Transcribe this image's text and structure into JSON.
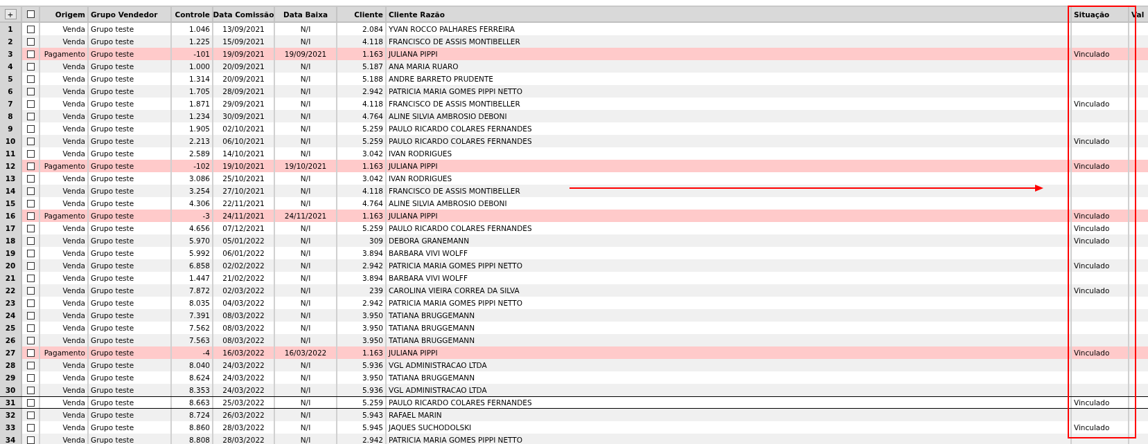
{
  "grid": {
    "expand_button": "+",
    "select_all_checked": false,
    "columns": [
      "Origem",
      "Grupo Vendedor",
      "Controle",
      "Data Comissão",
      "Data Baixa",
      "Cliente",
      "Cliente Razão",
      "Situação",
      "Val"
    ],
    "rows": [
      {
        "number": "1",
        "checked": false,
        "highlighted": false,
        "selected": false,
        "cells": [
          "Venda",
          "Grupo teste",
          "1.046",
          "13/09/2021",
          "N/I",
          "2.084",
          "YVAN ROCCO PALHARES FERREIRA"
        ]
      },
      {
        "number": "2",
        "checked": false,
        "highlighted": false,
        "selected": false,
        "cells": [
          "Venda",
          "Grupo teste",
          "1.225",
          "15/09/2021",
          "N/I",
          "4.118",
          "FRANCISCO DE ASSIS MONTIBELLER"
        ]
      },
      {
        "number": "3",
        "checked": false,
        "highlighted": true,
        "selected": false,
        "cells": [
          "Pagamento",
          "Grupo teste",
          "-101",
          "19/09/2021",
          "19/09/2021",
          "1.163",
          "JULIANA PIPPI"
        ],
        "situacao": "Vinculado"
      },
      {
        "number": "4",
        "checked": false,
        "highlighted": false,
        "selected": false,
        "cells": [
          "Venda",
          "Grupo teste",
          "1.000",
          "20/09/2021",
          "N/I",
          "5.187",
          "ANA MARIA RUARO"
        ]
      },
      {
        "number": "5",
        "checked": false,
        "highlighted": false,
        "selected": false,
        "cells": [
          "Venda",
          "Grupo teste",
          "1.314",
          "20/09/2021",
          "N/I",
          "5.188",
          "ANDRE BARRETO PRUDENTE"
        ]
      },
      {
        "number": "6",
        "checked": false,
        "highlighted": false,
        "selected": false,
        "cells": [
          "Venda",
          "Grupo teste",
          "1.705",
          "28/09/2021",
          "N/I",
          "2.942",
          "PATRICIA MARIA GOMES PIPPI NETTO"
        ]
      },
      {
        "number": "7",
        "checked": false,
        "highlighted": false,
        "selected": false,
        "cells": [
          "Venda",
          "Grupo teste",
          "1.871",
          "29/09/2021",
          "N/I",
          "4.118",
          "FRANCISCO DE ASSIS MONTIBELLER"
        ],
        "situacao": "Vinculado"
      },
      {
        "number": "8",
        "checked": false,
        "highlighted": false,
        "selected": false,
        "cells": [
          "Venda",
          "Grupo teste",
          "1.234",
          "30/09/2021",
          "N/I",
          "4.764",
          "ALINE SILVIA AMBROSIO DEBONI"
        ]
      },
      {
        "number": "9",
        "checked": false,
        "highlighted": false,
        "selected": false,
        "cells": [
          "Venda",
          "Grupo teste",
          "1.905",
          "02/10/2021",
          "N/I",
          "5.259",
          "PAULO RICARDO COLARES FERNANDES"
        ]
      },
      {
        "number": "10",
        "checked": false,
        "highlighted": false,
        "selected": false,
        "cells": [
          "Venda",
          "Grupo teste",
          "2.213",
          "06/10/2021",
          "N/I",
          "5.259",
          "PAULO RICARDO COLARES FERNANDES"
        ],
        "situacao": "Vinculado"
      },
      {
        "number": "11",
        "checked": false,
        "highlighted": false,
        "selected": false,
        "cells": [
          "Venda",
          "Grupo teste",
          "2.589",
          "14/10/2021",
          "N/I",
          "3.042",
          "IVAN RODRIGUES"
        ]
      },
      {
        "number": "12",
        "checked": false,
        "highlighted": true,
        "selected": false,
        "cells": [
          "Pagamento",
          "Grupo teste",
          "-102",
          "19/10/2021",
          "19/10/2021",
          "1.163",
          "JULIANA PIPPI"
        ],
        "situacao": "Vinculado"
      },
      {
        "number": "13",
        "checked": false,
        "highlighted": false,
        "selected": false,
        "cells": [
          "Venda",
          "Grupo teste",
          "3.086",
          "25/10/2021",
          "N/I",
          "3.042",
          "IVAN RODRIGUES"
        ]
      },
      {
        "number": "14",
        "checked": false,
        "highlighted": false,
        "selected": false,
        "cells": [
          "Venda",
          "Grupo teste",
          "3.254",
          "27/10/2021",
          "N/I",
          "4.118",
          "FRANCISCO DE ASSIS MONTIBELLER"
        ]
      },
      {
        "number": "15",
        "checked": false,
        "highlighted": false,
        "selected": false,
        "cells": [
          "Venda",
          "Grupo teste",
          "4.306",
          "22/11/2021",
          "N/I",
          "4.764",
          "ALINE SILVIA AMBROSIO DEBONI"
        ]
      },
      {
        "number": "16",
        "checked": false,
        "highlighted": true,
        "selected": false,
        "cells": [
          "Pagamento",
          "Grupo teste",
          "-3",
          "24/11/2021",
          "24/11/2021",
          "1.163",
          "JULIANA PIPPI"
        ],
        "situacao": "Vinculado"
      },
      {
        "number": "17",
        "checked": false,
        "highlighted": false,
        "selected": false,
        "cells": [
          "Venda",
          "Grupo teste",
          "4.656",
          "07/12/2021",
          "N/I",
          "5.259",
          "PAULO RICARDO COLARES FERNANDES"
        ],
        "situacao": "Vinculado"
      },
      {
        "number": "18",
        "checked": false,
        "highlighted": false,
        "selected": false,
        "cells": [
          "Venda",
          "Grupo teste",
          "5.970",
          "05/01/2022",
          "N/I",
          "309",
          "DEBORA GRANEMANN"
        ],
        "situacao": "Vinculado"
      },
      {
        "number": "19",
        "checked": false,
        "highlighted": false,
        "selected": false,
        "cells": [
          "Venda",
          "Grupo teste",
          "5.992",
          "06/01/2022",
          "N/I",
          "3.894",
          "BARBARA VIVI WOLFF"
        ]
      },
      {
        "number": "20",
        "checked": false,
        "highlighted": false,
        "selected": false,
        "cells": [
          "Venda",
          "Grupo teste",
          "6.858",
          "02/02/2022",
          "N/I",
          "2.942",
          "PATRICIA MARIA GOMES PIPPI NETTO"
        ],
        "situacao": "Vinculado"
      },
      {
        "number": "21",
        "checked": false,
        "highlighted": false,
        "selected": false,
        "cells": [
          "Venda",
          "Grupo teste",
          "1.447",
          "21/02/2022",
          "N/I",
          "3.894",
          "BARBARA VIVI WOLFF"
        ]
      },
      {
        "number": "22",
        "checked": false,
        "highlighted": false,
        "selected": false,
        "cells": [
          "Venda",
          "Grupo teste",
          "7.872",
          "02/03/2022",
          "N/I",
          "239",
          "CAROLINA VIEIRA CORREA DA SILVA"
        ],
        "situacao": "Vinculado"
      },
      {
        "number": "23",
        "checked": false,
        "highlighted": false,
        "selected": false,
        "cells": [
          "Venda",
          "Grupo teste",
          "8.035",
          "04/03/2022",
          "N/I",
          "2.942",
          "PATRICIA MARIA GOMES PIPPI NETTO"
        ]
      },
      {
        "number": "24",
        "checked": false,
        "highlighted": false,
        "selected": false,
        "cells": [
          "Venda",
          "Grupo teste",
          "7.391",
          "08/03/2022",
          "N/I",
          "3.950",
          "TATIANA BRUGGEMANN"
        ]
      },
      {
        "number": "25",
        "checked": false,
        "highlighted": false,
        "selected": false,
        "cells": [
          "Venda",
          "Grupo teste",
          "7.562",
          "08/03/2022",
          "N/I",
          "3.950",
          "TATIANA BRUGGEMANN"
        ]
      },
      {
        "number": "26",
        "checked": false,
        "highlighted": false,
        "selected": false,
        "cells": [
          "Venda",
          "Grupo teste",
          "7.563",
          "08/03/2022",
          "N/I",
          "3.950",
          "TATIANA BRUGGEMANN"
        ]
      },
      {
        "number": "27",
        "checked": false,
        "highlighted": true,
        "selected": false,
        "cells": [
          "Pagamento",
          "Grupo teste",
          "-4",
          "16/03/2022",
          "16/03/2022",
          "1.163",
          "JULIANA PIPPI"
        ],
        "situacao": "Vinculado"
      },
      {
        "number": "28",
        "checked": false,
        "highlighted": false,
        "selected": false,
        "cells": [
          "Venda",
          "Grupo teste",
          "8.040",
          "24/03/2022",
          "N/I",
          "5.936",
          "VGL ADMINISTRACAO LTDA"
        ]
      },
      {
        "number": "29",
        "checked": false,
        "highlighted": false,
        "selected": false,
        "cells": [
          "Venda",
          "Grupo teste",
          "8.624",
          "24/03/2022",
          "N/I",
          "3.950",
          "TATIANA BRUGGEMANN"
        ]
      },
      {
        "number": "30",
        "checked": false,
        "highlighted": false,
        "selected": false,
        "cells": [
          "Venda",
          "Grupo teste",
          "8.353",
          "24/03/2022",
          "N/I",
          "5.936",
          "VGL ADMINISTRACAO LTDA"
        ]
      },
      {
        "number": "31",
        "checked": false,
        "highlighted": false,
        "selected": true,
        "cells": [
          "Venda",
          "Grupo teste",
          "8.663",
          "25/03/2022",
          "N/I",
          "5.259",
          "PAULO RICARDO COLARES FERNANDES"
        ],
        "situacao": "Vinculado"
      },
      {
        "number": "32",
        "checked": false,
        "highlighted": false,
        "selected": false,
        "cells": [
          "Venda",
          "Grupo teste",
          "8.724",
          "26/03/2022",
          "N/I",
          "5.943",
          "RAFAEL MARIN"
        ]
      },
      {
        "number": "33",
        "checked": false,
        "highlighted": false,
        "selected": false,
        "cells": [
          "Venda",
          "Grupo teste",
          "8.860",
          "28/03/2022",
          "N/I",
          "5.945",
          "JAQUES SUCHODOLSKI"
        ],
        "situacao": "Vinculado"
      },
      {
        "number": "34",
        "checked": false,
        "highlighted": false,
        "selected": false,
        "cells": [
          "Venda",
          "Grupo teste",
          "8.808",
          "28/03/2022",
          "N/I",
          "2.942",
          "PATRICIA MARIA GOMES PIPPI NETTO"
        ]
      }
    ]
  }
}
